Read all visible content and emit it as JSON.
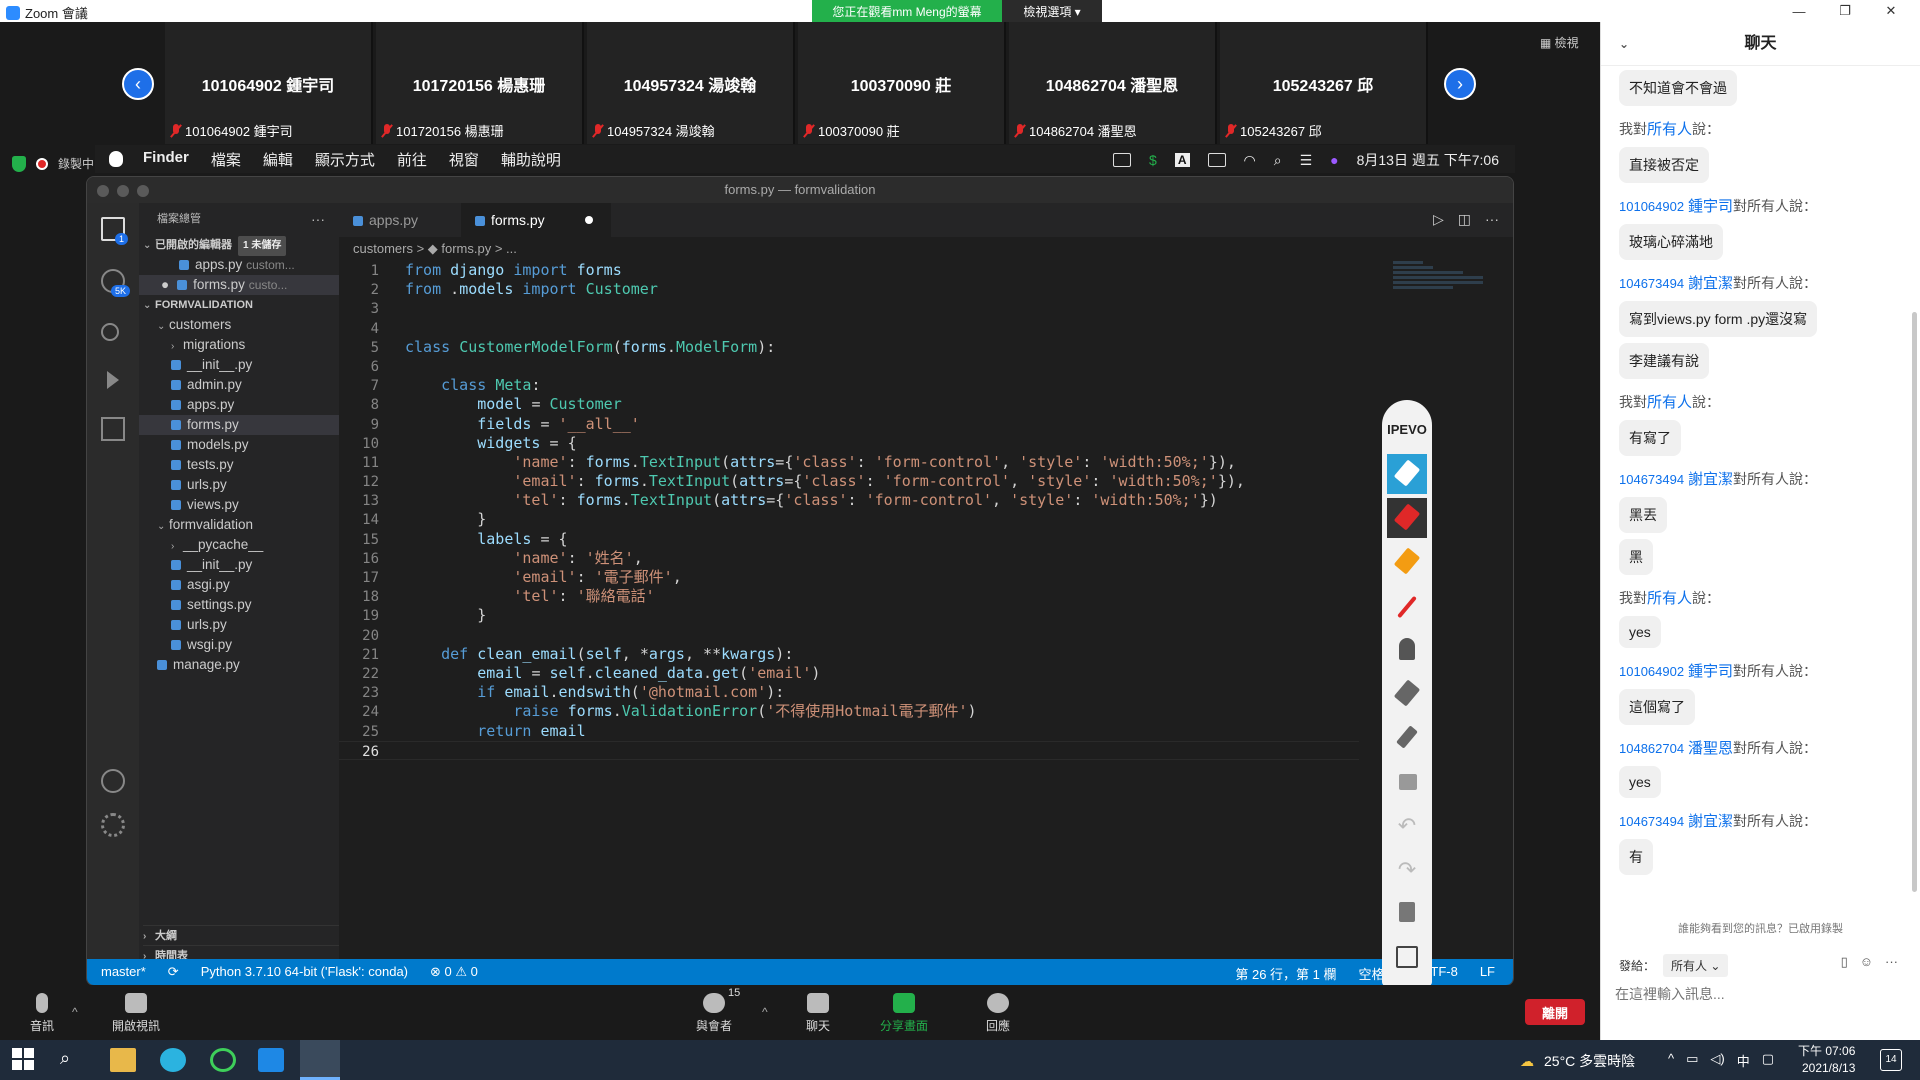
{
  "zoom": {
    "window_title": "Zoom 會議",
    "viewing_banner": "您正在觀看mm Meng的螢幕",
    "view_options": "檢視選項 ▾",
    "view_toggle": "▦ 檢視",
    "recording": "錄製中",
    "participants": [
      {
        "big": "101064902 鍾宇司",
        "small": "101064902 鍾宇司"
      },
      {
        "big": "101720156 楊惠珊",
        "small": "101720156 楊惠珊"
      },
      {
        "big": "104957324 湯竣翰",
        "small": "104957324 湯竣翰"
      },
      {
        "big": "100370090 莊",
        "small": "100370090 莊"
      },
      {
        "big": "104862704 潘聖恩",
        "small": "104862704 潘聖恩"
      },
      {
        "big": "105243267 邱",
        "small": "105243267 邱"
      }
    ],
    "bottom": {
      "audio": "音訊",
      "video": "開啟視訊",
      "participants": "與會者",
      "participant_count": "15",
      "chat": "聊天",
      "share": "分享畫面",
      "reactions": "回應",
      "end": "離開"
    }
  },
  "mac": {
    "menus": [
      "Finder",
      "檔案",
      "編輯",
      "顯示方式",
      "前往",
      "視窗",
      "輔助說明"
    ],
    "input_letter": "A",
    "datetime": "8月13日 週五 下午7:06"
  },
  "vscode": {
    "window_title": "forms.py — formvalidation",
    "sidebar_title": "檔案總管",
    "sidebar_more": "···",
    "open_editors": "已開啟的編輯器",
    "unsaved_badge": "1 未儲存",
    "open_files": [
      {
        "name": "apps.py",
        "path": "custom..."
      },
      {
        "name": "forms.py",
        "path": "custo..."
      }
    ],
    "project": "FORMVALIDATION",
    "tree": [
      {
        "label": "customers",
        "kind": "folder",
        "indent": 1
      },
      {
        "label": "migrations",
        "kind": "folder-closed",
        "indent": 2
      },
      {
        "label": "__init__.py",
        "kind": "py",
        "indent": 2
      },
      {
        "label": "admin.py",
        "kind": "py",
        "indent": 2
      },
      {
        "label": "apps.py",
        "kind": "py",
        "indent": 2
      },
      {
        "label": "forms.py",
        "kind": "py",
        "indent": 2,
        "active": true
      },
      {
        "label": "models.py",
        "kind": "py",
        "indent": 2
      },
      {
        "label": "tests.py",
        "kind": "py",
        "indent": 2
      },
      {
        "label": "urls.py",
        "kind": "py",
        "indent": 2
      },
      {
        "label": "views.py",
        "kind": "py",
        "indent": 2
      },
      {
        "label": "formvalidation",
        "kind": "folder",
        "indent": 1
      },
      {
        "label": "__pycache__",
        "kind": "folder-closed",
        "indent": 2
      },
      {
        "label": "__init__.py",
        "kind": "py",
        "indent": 2
      },
      {
        "label": "asgi.py",
        "kind": "py",
        "indent": 2
      },
      {
        "label": "settings.py",
        "kind": "py",
        "indent": 2
      },
      {
        "label": "urls.py",
        "kind": "py",
        "indent": 2
      },
      {
        "label": "wsgi.py",
        "kind": "py",
        "indent": 2
      },
      {
        "label": "manage.py",
        "kind": "py",
        "indent": 1
      }
    ],
    "outline": "大綱",
    "timeline": "時間表",
    "tabs": [
      "apps.py",
      "forms.py"
    ],
    "breadcrumb": "customers > ◆ forms.py > ...",
    "code": [
      "from django import forms",
      "from .models import Customer",
      "",
      "",
      "class CustomerModelForm(forms.ModelForm):",
      "",
      "    class Meta:",
      "        model = Customer",
      "        fields = '__all__'",
      "        widgets = {",
      "            'name': forms.TextInput(attrs={'class': 'form-control', 'style': 'width:50%;'}),",
      "            'email': forms.TextInput(attrs={'class': 'form-control', 'style': 'width:50%;'}),",
      "            'tel': forms.TextInput(attrs={'class': 'form-control', 'style': 'width:50%;'})",
      "        }",
      "        labels = {",
      "            'name': '姓名',",
      "            'email': '電子郵件',",
      "            'tel': '聯絡電話'",
      "        }",
      "",
      "    def clean_email(self, *args, **kwargs):",
      "        email = self.cleaned_data.get('email')",
      "        if email.endswith('@hotmail.com'):",
      "            raise forms.ValidationError('不得使用Hotmail電子郵件')",
      "        return email",
      ""
    ],
    "current_line": 26,
    "status_left": [
      "master*",
      "⟳",
      "Python 3.7.10 64-bit ('Flask': conda)",
      "⊗ 0 ⚠ 0"
    ],
    "status_right": [
      "第 26 行，第 1 欄",
      "空格: 4",
      "UTF-8",
      "LF"
    ],
    "scm_badge": "5K",
    "files_badge": "1"
  },
  "ipevo": {
    "logo": "IPEVO"
  },
  "chat": {
    "title": "聊天",
    "messages": [
      {
        "head": null,
        "text": "不知道會不會過"
      },
      {
        "head": {
          "pre": "我對",
          "name": "所有人",
          "post": "說："
        },
        "text": "直接被否定"
      },
      {
        "head": {
          "num": "101064902",
          "name": "鍾宇司",
          "post": "對所有人說："
        },
        "text": "玻璃心碎滿地"
      },
      {
        "head": {
          "num": "104673494",
          "name": "謝宜潔",
          "post": "對所有人說："
        },
        "text": "寫到views.py form .py還沒寫"
      },
      {
        "head": null,
        "text": "李建議有說"
      },
      {
        "head": {
          "pre": "我對",
          "name": "所有人",
          "post": "說："
        },
        "text": "有寫了"
      },
      {
        "head": {
          "num": "104673494",
          "name": "謝宜潔",
          "post": "對所有人說："
        },
        "text": "黑丟"
      },
      {
        "head": null,
        "text": "黑"
      },
      {
        "head": {
          "pre": "我對",
          "name": "所有人",
          "post": "說："
        },
        "text": "yes"
      },
      {
        "head": {
          "num": "101064902",
          "name": "鍾宇司",
          "post": "對所有人說："
        },
        "text": "這個寫了"
      },
      {
        "head": {
          "num": "104862704",
          "name": "潘聖恩",
          "post": "對所有人說："
        },
        "text": "yes"
      },
      {
        "head": {
          "num": "104673494",
          "name": "謝宜潔",
          "post": "對所有人說："
        },
        "text": "有"
      }
    ],
    "notice": "誰能夠看到您的訊息？已啟用錄製",
    "send_to_label": "發給：",
    "send_to_value": "所有人 ⌄",
    "input_placeholder": "在這裡輸入訊息..."
  },
  "taskbar": {
    "weather": "25°C  多雲時陰",
    "ime": "中",
    "time": "下午 07:06",
    "date": "2021/8/13",
    "notify_count": "14"
  }
}
